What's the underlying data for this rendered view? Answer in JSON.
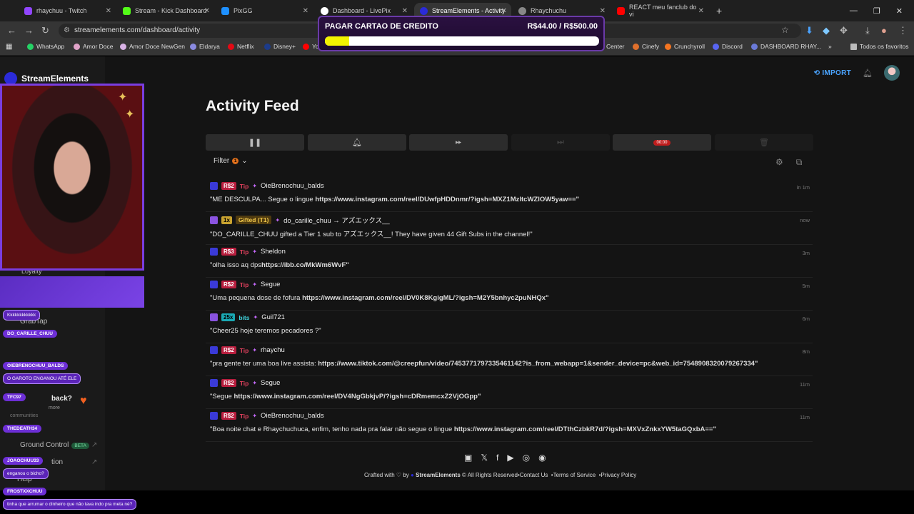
{
  "browser": {
    "tabs": [
      {
        "label": "rhaychuu - Twitch",
        "color": "#9146ff"
      },
      {
        "label": "Stream - Kick Dashboard",
        "color": "#53fc18"
      },
      {
        "label": "PixGG",
        "color": "#1e90ff"
      },
      {
        "label": "Dashboard - LivePix",
        "color": "#ffffff"
      },
      {
        "label": "StreamElements - Activity",
        "color": "#2b2bd9"
      },
      {
        "label": "Rhaychuchu",
        "color": "#888888"
      },
      {
        "label": "REACT meu fanclub do vi",
        "color": "#ff0000"
      }
    ],
    "url": "streamelements.com/dashboard/activity",
    "bookmarks": [
      "WhatsApp",
      "Amor Doce",
      "Amor Doce NewGen",
      "Eldarya",
      "Netflix",
      "Disney+",
      "Yo",
      "Center",
      "Cinefy",
      "Crunchyroll",
      "Discord",
      "DASHBOARD RHAY...",
      "Todos os favoritos"
    ]
  },
  "overlay": {
    "goal_title": "PAGAR CARTAO DE CREDITO",
    "goal_amount": "R$44.00 / R$500.00",
    "goal_progress": 0.088
  },
  "app": {
    "logo": "StreamElements",
    "import_label": "IMPORT",
    "page_title": "Activity Feed",
    "timer": "00:00",
    "filter_label": "Filter",
    "filter_count": "1",
    "sidebar": {
      "loyalty": "Loyalty",
      "grabtap": "GrabTap",
      "back_title": "back?",
      "back_more": "more",
      "communities": "communities",
      "ground_control": "Ground Control",
      "beta": "BETA",
      "tion": "tion",
      "help": "Help"
    }
  },
  "feed": [
    {
      "platform": "se",
      "amount": "R$2",
      "amount_style": "red",
      "tag": "Tip",
      "tag_style": "red",
      "user": "OieBrenochuu_balds",
      "message": "\"ME DESCULPA... Segue o lingue ",
      "link": "https://www.instagram.com/reel/DUwfpHDDnmr/?igsh=MXZ1MzltcWZlOW5yaw==\"",
      "time": "in 1m"
    },
    {
      "platform": "tw",
      "amount": "1x",
      "amount_style": "gold",
      "tag": "Gifted (T1)",
      "tag_style": "gifted",
      "user": "do_carille_chuu → アズエックス__",
      "message": "\"DO_CARILLE_CHUU gifted a Tier 1 sub to アズエックス__! They have given 44 Gift Subs in the channel!\"",
      "link": "",
      "time": "now"
    },
    {
      "platform": "se",
      "amount": "R$3",
      "amount_style": "red",
      "tag": "Tip",
      "tag_style": "red",
      "user": "Sheldon",
      "message": "\"olha isso aq dps",
      "link": "https://ibb.co/MkWm6WvF\"",
      "time": "3m"
    },
    {
      "platform": "se",
      "amount": "R$2",
      "amount_style": "red",
      "tag": "Tip",
      "tag_style": "red",
      "user": "Segue",
      "message": "\"Uma pequena dose de fofura ",
      "link": "https://www.instagram.com/reel/DV0K8KgigML/?igsh=M2Y5bnhyc2puNHQx\"",
      "time": "5m"
    },
    {
      "platform": "tw",
      "amount": "25x",
      "amount_style": "teal",
      "tag": "bits",
      "tag_style": "teal",
      "user": "Guil721",
      "message": "\"Cheer25 hoje teremos pecadores ?\"",
      "link": "",
      "time": "6m"
    },
    {
      "platform": "se",
      "amount": "R$2",
      "amount_style": "red",
      "tag": "Tip",
      "tag_style": "red",
      "user": "rhaychu",
      "message": "\"pra gente ter uma boa live assista: ",
      "link": "https://www.tiktok.com/@creepfun/video/7453771797335461142?is_from_webapp=1&sender_device=pc&web_id=7548908320079267334\"",
      "time": "8m"
    },
    {
      "platform": "se",
      "amount": "R$2",
      "amount_style": "red",
      "tag": "Tip",
      "tag_style": "red",
      "user": "Segue",
      "message": "\"Segue ",
      "link": "https://www.instagram.com/reel/DV4NgGbkjvP/?igsh=cDRmemcxZ2VjOGpp\"",
      "time": "11m"
    },
    {
      "platform": "se",
      "amount": "R$2",
      "amount_style": "red",
      "tag": "Tip",
      "tag_style": "red",
      "user": "OieBrenochuu_balds",
      "message": "\"Boa noite chat e Rhaychuchuca, enfim, tenho nada pra falar não segue o lingue ",
      "link": "https://www.instagram.com/reel/DTthCzbkR7d/?igsh=MXVxZnkxYW5taGQxbA==\"",
      "time": "11m"
    }
  ],
  "footer": {
    "crafted": "Crafted with",
    "by": "by",
    "brand": "StreamElements",
    "rights": "© All Rights Reserved",
    "contact": "•Contact Us",
    "terms": "•Terms of Service",
    "privacy": "•Privacy Policy"
  },
  "chat": [
    {
      "name": "",
      "msg": "Kkkkkkkkkkkk"
    },
    {
      "name": "DO_CARILLE_CHUU",
      "msg": ""
    },
    {
      "name": "OIEBRENOCHUU_BALDS",
      "msg": "O GAROTO ENGANOU ATÉ ELE"
    },
    {
      "name": "TFC97",
      "msg": ""
    },
    {
      "name": "THEDEATH34",
      "msg": ""
    },
    {
      "name": "JOAOCHUU33",
      "msg": "enganou o bicho?"
    },
    {
      "name": "FROSTXXCHUU",
      "msg": "tinha que arrumar o dinheiro que não tava indo pra meta né?"
    }
  ]
}
